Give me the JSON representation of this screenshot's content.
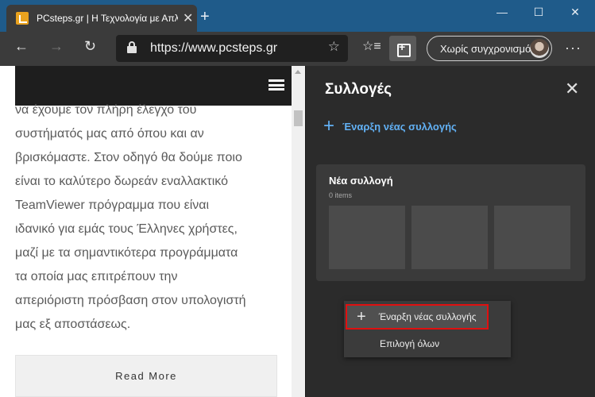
{
  "browser": {
    "tab_title": "PCsteps.gr | Η Τεχνολογία με Απλά Λόγια",
    "url": "https://www.pcsteps.gr",
    "sync_label": "Χωρίς συγχρονισμό"
  },
  "page": {
    "article_lines": [
      "να έχουμε τον πλήρη έλεγχο του",
      "συστήματός μας από όπου και αν",
      "βρισκόμαστε. Στον οδηγό θα δούμε ποιο",
      "είναι το καλύτερο δωρεάν εναλλακτικό",
      "TeamViewer πρόγραμμα που είναι",
      "ιδανικό για εμάς τους Έλληνες χρήστες,",
      "μαζί με τα σημαντικότερα προγράμματα",
      "τα οποία μας επιτρέπουν την",
      "απεριόριστη πρόσβαση στον υπολογιστή",
      "μας εξ αποστάσεως."
    ],
    "read_more": "Read More"
  },
  "collections_panel": {
    "title": "Συλλογές",
    "new_collection": "Έναρξη νέας συλλογής",
    "card": {
      "name": "Νέα συλλογή",
      "count": "0 items"
    }
  },
  "context_menu": {
    "items": [
      "Έναρξη νέας συλλογής",
      "Επιλογή όλων"
    ],
    "highlight_color": "#e01010"
  },
  "colors": {
    "titlebar": "#1f5b8a",
    "toolbar": "#3b3b3b",
    "panel": "#2b2b2b",
    "accent": "#62b1f5"
  }
}
